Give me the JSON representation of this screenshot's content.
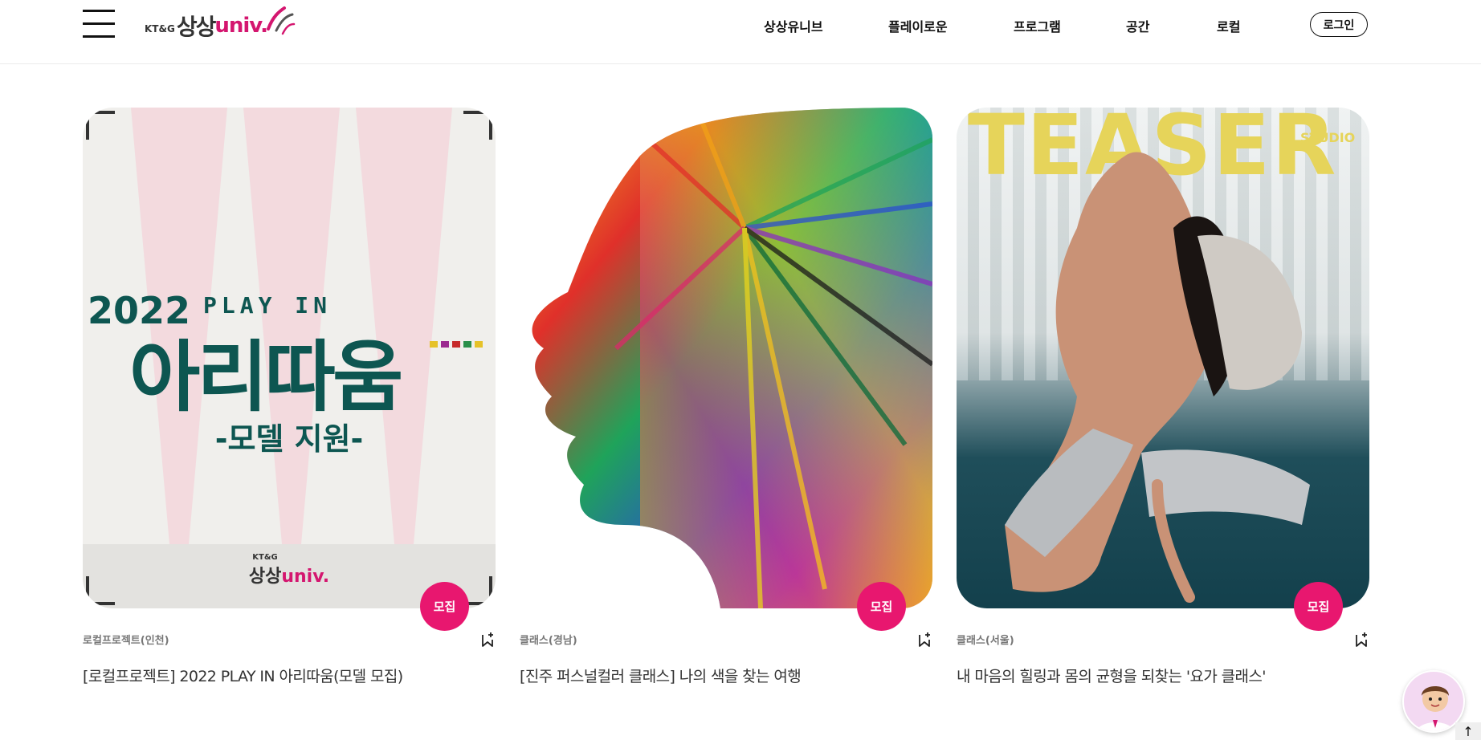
{
  "header": {
    "logo": {
      "ktg": "KT&G",
      "sangsang": "상상",
      "univ": "univ."
    },
    "nav": [
      {
        "label": "상상유니브"
      },
      {
        "label": "플레이로운"
      },
      {
        "label": "프로그램"
      },
      {
        "label": "공간"
      },
      {
        "label": "로컬"
      }
    ],
    "login_label": "로그인"
  },
  "cards": [
    {
      "badge": "모집",
      "category": "로컬프로젝트(인천)",
      "title": "[로컬프로젝트] 2022 PLAY IN 아리따움(모델 모집)",
      "art": {
        "year": "2022",
        "play": "PLAY IN",
        "main": "아리따움",
        "sub": "-모델 지원-",
        "mini_ktg": "KT&G",
        "mini_ss": "상상",
        "mini_univ": "univ."
      }
    },
    {
      "badge": "모집",
      "category": "클래스(경남)",
      "title": "[진주 퍼스널컬러 클래스] 나의 색을 찾는 여행"
    },
    {
      "badge": "모집",
      "category": "클래스(서울)",
      "title": "내 마음의 힐링과 몸의 균형을 되찾는 '요가 클래스'",
      "art": {
        "teaser": "TEASER",
        "studio": "STUDIO"
      }
    }
  ],
  "colors": {
    "accent": "#e8176f",
    "brand_pink": "#d4166f",
    "teal": "#0d5651"
  },
  "icons": {
    "menu": "hamburger-icon",
    "bookmark": "bookmark-add-icon",
    "chatbot": "chatbot-avatar-icon",
    "scroll_top": "arrow-up-icon"
  }
}
